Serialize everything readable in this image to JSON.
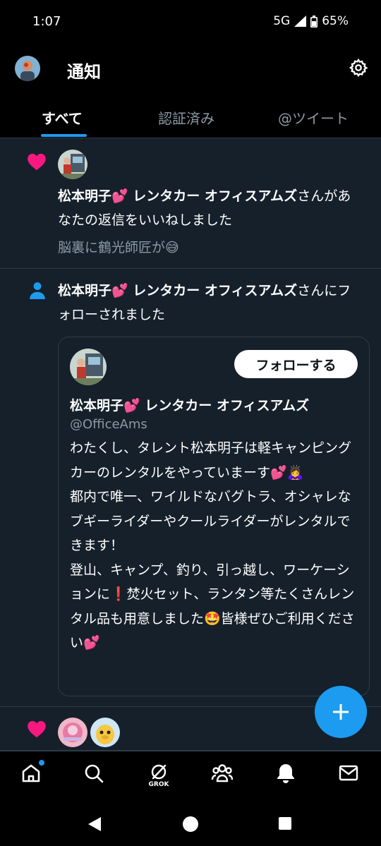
{
  "status_bar": {
    "time": "1:07",
    "network": "5G",
    "battery": "65%"
  },
  "header": {
    "title": "通知"
  },
  "tabs": [
    {
      "label": "すべて",
      "active": true
    },
    {
      "label": "認証済み",
      "active": false
    },
    {
      "label": "@ツイート",
      "active": false
    }
  ],
  "notifications": [
    {
      "type": "like",
      "icon": "heart-icon",
      "user": "松本明子💕 レンタカー オフィスアムズ",
      "action": "さんがあなたの返信をいいねしました",
      "quote": "脳裏に鶴光師匠が😅"
    },
    {
      "type": "follow",
      "icon": "person-icon",
      "user": "松本明子💕 レンタカー オフィスアムズ",
      "action": "さんにフォローされました",
      "card": {
        "follow_label": "フォローする",
        "name": "松本明子💕 レンタカー オフィスアムズ",
        "handle": "@OfficeAms",
        "bio": "わたくし、タレント松本明子は軽キャンピングカーのレンタルをやっていまーす💕🙇‍♀️\n都内で唯一、ワイルドなバグトラ、オシャレなブギーライダーやクールライダーがレンタルできます！\n登山、キャンプ、釣り、引っ越し、ワーケーションに❗焚火セット、ランタン等たくさんレンタル品も用意しました🤩皆様ぜひご利用ください💕"
      }
    },
    {
      "type": "like",
      "icon": "heart-icon"
    }
  ],
  "bottom_nav": {
    "grok_label": "GROK"
  },
  "colors": {
    "accent": "#1d9bf0",
    "like": "#f91880",
    "background": "#15202b"
  }
}
